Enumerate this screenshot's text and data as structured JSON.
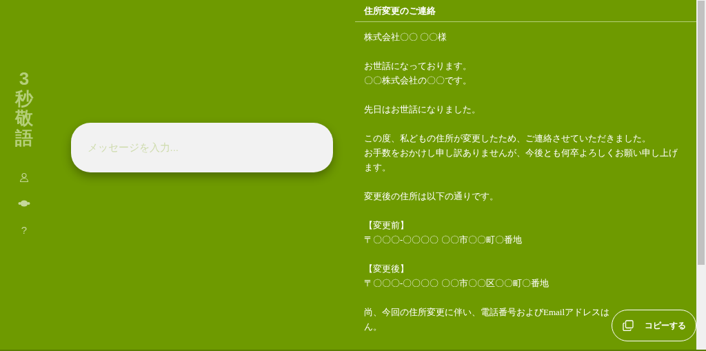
{
  "sidebar": {
    "logo": "3秒敬語",
    "items": [
      {
        "kind": "user"
      },
      {
        "kind": "mask"
      },
      {
        "kind": "help",
        "label": "?"
      }
    ]
  },
  "composer": {
    "placeholder": "メッセージを入力..."
  },
  "letter": {
    "title": "住所変更のご連絡",
    "paragraphs": [
      [
        "株式会社〇〇 〇〇様"
      ],
      [
        "お世話になっております。",
        "〇〇株式会社の〇〇です。"
      ],
      [
        "先日はお世話になりました。"
      ],
      [
        "この度、私どもの住所が変更したため、ご連絡させていただきました。",
        "お手数をおかけし申し訳ありませんが、今後とも何卒よろしくお願い申し上げます。"
      ],
      [
        "変更後の住所は以下の通りです。"
      ],
      [
        "【変更前】",
        "〒〇〇〇-〇〇〇〇 〇〇市〇〇町〇番地"
      ],
      [
        "【変更後】",
        "〒〇〇〇-〇〇〇〇 〇〇市〇〇区〇〇町〇番地"
      ],
      [
        "尚、今回の住所変更に伴い、電話番号およびEmailアドレスは",
        "ん。"
      ]
    ]
  },
  "copy_button": {
    "label": "コピーする"
  }
}
